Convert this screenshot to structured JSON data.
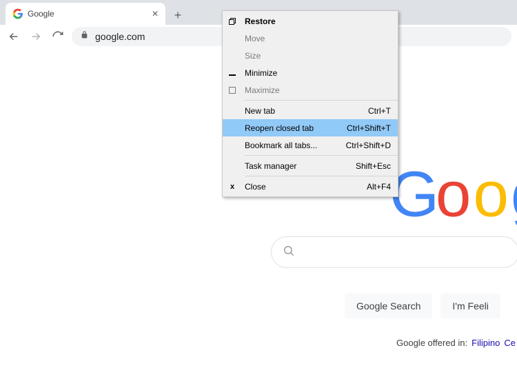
{
  "tab": {
    "title": "Google"
  },
  "address_bar": {
    "url": "google.com"
  },
  "context_menu": {
    "items": [
      {
        "type": "item",
        "label": "Restore",
        "shortcut": "",
        "bold": true,
        "icon": "restore"
      },
      {
        "type": "item",
        "label": "Move",
        "shortcut": "",
        "disabled": true
      },
      {
        "type": "item",
        "label": "Size",
        "shortcut": "",
        "disabled": true
      },
      {
        "type": "item",
        "label": "Minimize",
        "shortcut": "",
        "icon": "minimize"
      },
      {
        "type": "item",
        "label": "Maximize",
        "shortcut": "",
        "disabled": true,
        "icon": "maximize"
      },
      {
        "type": "separator"
      },
      {
        "type": "item",
        "label": "New tab",
        "shortcut": "Ctrl+T"
      },
      {
        "type": "item",
        "label": "Reopen closed tab",
        "shortcut": "Ctrl+Shift+T",
        "highlighted": true
      },
      {
        "type": "item",
        "label": "Bookmark all tabs...",
        "shortcut": "Ctrl+Shift+D"
      },
      {
        "type": "separator"
      },
      {
        "type": "item",
        "label": "Task manager",
        "shortcut": "Shift+Esc"
      },
      {
        "type": "separator"
      },
      {
        "type": "item",
        "label": "Close",
        "shortcut": "Alt+F4",
        "icon": "close"
      }
    ]
  },
  "buttons": {
    "search": "Google Search",
    "lucky": "I'm Feeli"
  },
  "offered": {
    "label": "Google offered in:",
    "lang1": "Filipino",
    "lang2": "Ce"
  }
}
